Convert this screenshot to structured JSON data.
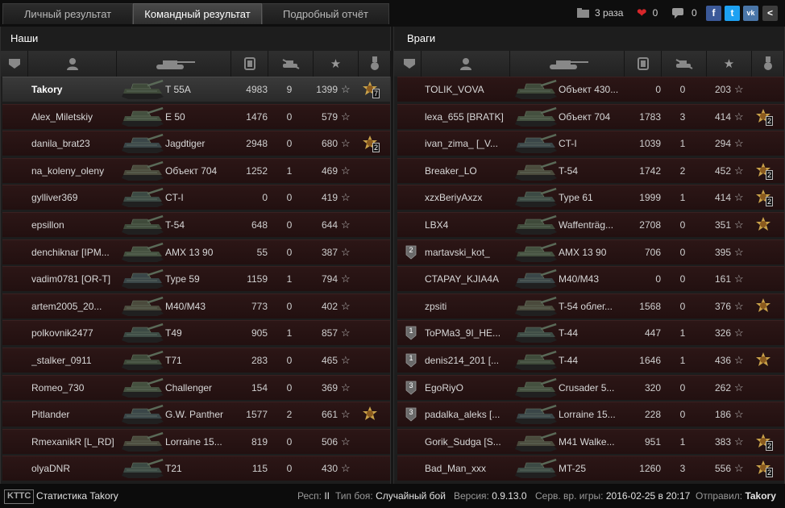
{
  "tabs": [
    "Личный результат",
    "Командный результат",
    "Подробный отчёт"
  ],
  "social": {
    "views": "3 раза",
    "likes": "0",
    "comments": "0"
  },
  "share_icons": [
    "f",
    "t",
    "vk",
    "<"
  ],
  "left": {
    "title": "Наши",
    "rows": [
      {
        "name": "Takory",
        "tank": "T 55A",
        "damage": "4983",
        "frags": "9",
        "exp": "1399",
        "medal": "7",
        "me": true
      },
      {
        "name": "Alex_Miletskiy",
        "tank": "E 50",
        "damage": "1476",
        "frags": "0",
        "exp": "579"
      },
      {
        "name": "danila_brat23",
        "tank": "Jagdtiger",
        "damage": "2948",
        "frags": "0",
        "exp": "680",
        "medal": "2"
      },
      {
        "name": "na_koleny_oleny",
        "tank": "Объект 704",
        "damage": "1252",
        "frags": "1",
        "exp": "469"
      },
      {
        "name": "gylliver369",
        "tank": "CT-I",
        "damage": "0",
        "frags": "0",
        "exp": "419"
      },
      {
        "name": "epsillon",
        "tank": "T-54",
        "damage": "648",
        "frags": "0",
        "exp": "644"
      },
      {
        "name": "denchiknar [IPM...",
        "tank": "AMX 13 90",
        "damage": "55",
        "frags": "0",
        "exp": "387"
      },
      {
        "name": "vadim0781 [OR-T]",
        "tank": "Type 59",
        "damage": "1159",
        "frags": "1",
        "exp": "794"
      },
      {
        "name": "artem2005_20...",
        "tank": "M40/M43",
        "damage": "773",
        "frags": "0",
        "exp": "402"
      },
      {
        "name": "polkovnik2477",
        "tank": "T49",
        "damage": "905",
        "frags": "1",
        "exp": "857"
      },
      {
        "name": "_stalker_0911",
        "tank": "T71",
        "damage": "283",
        "frags": "0",
        "exp": "465"
      },
      {
        "name": "Romeo_730",
        "tank": "Challenger",
        "damage": "154",
        "frags": "0",
        "exp": "369"
      },
      {
        "name": "Pitlander",
        "tank": "G.W. Panther",
        "damage": "1577",
        "frags": "2",
        "exp": "661",
        "medal": ""
      },
      {
        "name": "RmexanikR [L_RD]",
        "tank": "Lorraine 15...",
        "damage": "819",
        "frags": "0",
        "exp": "506"
      },
      {
        "name": "olyaDNR",
        "tank": "T21",
        "damage": "115",
        "frags": "0",
        "exp": "430"
      }
    ]
  },
  "right": {
    "title": "Враги",
    "rows": [
      {
        "name": "TOLIK_VOVA",
        "tank": "Объект 430...",
        "damage": "0",
        "frags": "0",
        "exp": "203"
      },
      {
        "name": "lexa_655 [BRATK]",
        "tank": "Объект 704",
        "damage": "1783",
        "frags": "3",
        "exp": "414",
        "medal": "2"
      },
      {
        "name": "ivan_zima_ [_V...",
        "tank": "CT-I",
        "damage": "1039",
        "frags": "1",
        "exp": "294"
      },
      {
        "name": "Breaker_LO",
        "tank": "T-54",
        "damage": "1742",
        "frags": "2",
        "exp": "452",
        "medal": "2"
      },
      {
        "name": "xzxBeriyAxzx",
        "tank": "Type 61",
        "damage": "1999",
        "frags": "1",
        "exp": "414",
        "medal": "2"
      },
      {
        "name": "LBX4",
        "tank": "Waffenträg...",
        "damage": "2708",
        "frags": "0",
        "exp": "351",
        "medal": ""
      },
      {
        "name": "martavski_kot_",
        "tank": "AMX 13 90",
        "damage": "706",
        "frags": "0",
        "exp": "395",
        "rank": "2"
      },
      {
        "name": "CTAPAY_KJIA4A",
        "tank": "M40/M43",
        "damage": "0",
        "frags": "0",
        "exp": "161"
      },
      {
        "name": "zpsiti",
        "tank": "T-54 облег...",
        "damage": "1568",
        "frags": "0",
        "exp": "376",
        "medal": ""
      },
      {
        "name": "ToPMa3_9I_HE...",
        "tank": "T-44",
        "damage": "447",
        "frags": "1",
        "exp": "326",
        "rank": "1"
      },
      {
        "name": "denis214_201 [...",
        "tank": "T-44",
        "damage": "1646",
        "frags": "1",
        "exp": "436",
        "medal": "",
        "rank": "1"
      },
      {
        "name": "EgoRiyO",
        "tank": "Crusader 5...",
        "damage": "320",
        "frags": "0",
        "exp": "262",
        "rank": "3"
      },
      {
        "name": "padalka_aleks [...",
        "tank": "Lorraine 15...",
        "damage": "228",
        "frags": "0",
        "exp": "186",
        "rank": "3"
      },
      {
        "name": "Gorik_Sudga [S...",
        "tank": "M41 Walke...",
        "damage": "951",
        "frags": "1",
        "exp": "383",
        "medal": "2"
      },
      {
        "name": "Bad_Man_xxx",
        "tank": "MT-25",
        "damage": "1260",
        "frags": "3",
        "exp": "556",
        "medal": "2"
      }
    ]
  },
  "footer": {
    "logo": "KTTC",
    "stats_label": "Статистика Takory",
    "server_label": "Респ:",
    "server_value": "II",
    "battle_label": "Тип боя:",
    "battle_value": "Случайный бой",
    "version_label": "Версия:",
    "version_value": "0.9.13.0",
    "time_label": "Серв. вр. игры:",
    "time_value": "2016-02-25 в 20:17",
    "sender_label": "Отправил:",
    "sender_value": "Takory"
  },
  "colors": {
    "row_bg": "#2a1414",
    "me_row": "#363636",
    "accent": "#ffffff"
  }
}
